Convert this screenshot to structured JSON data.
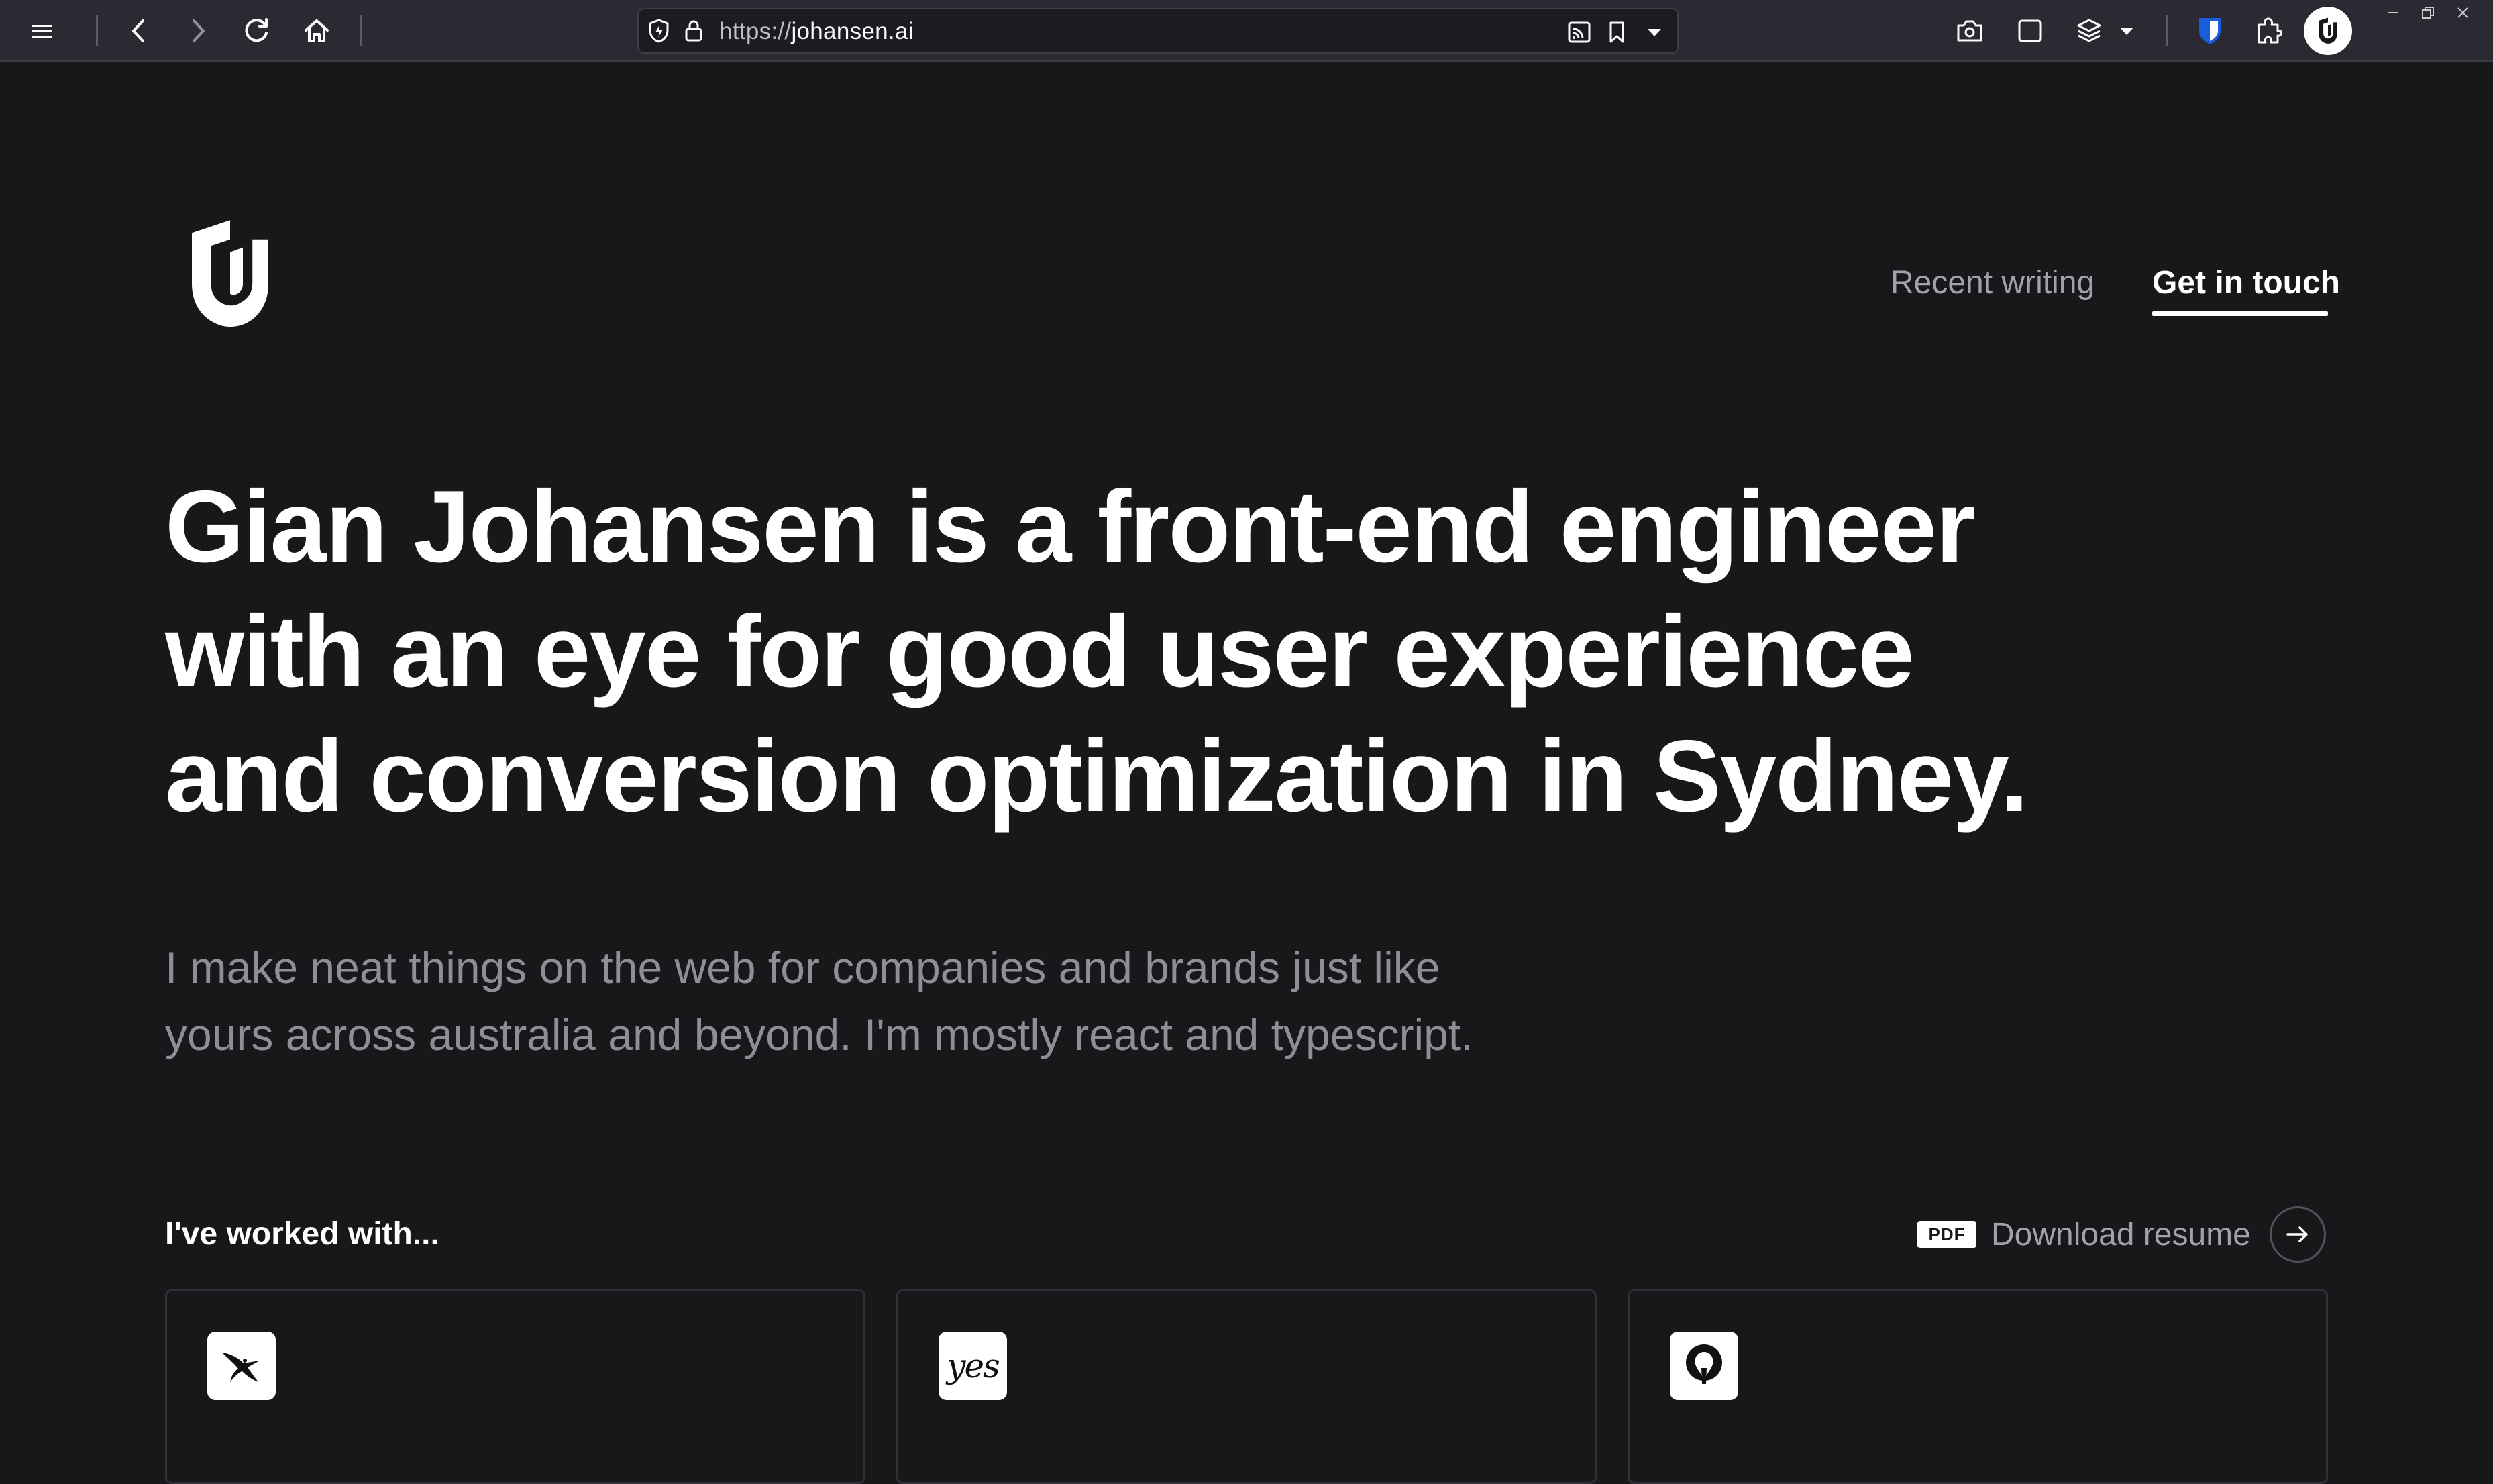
{
  "browser": {
    "url_scheme": "https://",
    "url_host": "johansen.ai",
    "icons": {
      "menu": "hamburger-menu-icon",
      "back": "back-arrow-icon",
      "forward": "forward-arrow-icon",
      "reload": "reload-icon",
      "home": "home-icon",
      "shield": "tracking-protection-icon",
      "lock": "lock-icon",
      "reader": "reader-view-icon",
      "bookmark": "bookmark-icon",
      "dropdown": "chevron-down-icon",
      "screenshot": "camera-icon",
      "sidebar": "sidebar-icon",
      "layers": "layers-icon",
      "bitwarden": "bitwarden-shield-icon",
      "extensions": "puzzle-piece-icon",
      "site_extension": "johansen-logo-icon"
    }
  },
  "nav": {
    "recent_writing": "Recent writing",
    "get_in_touch": "Get in touch"
  },
  "hero": {
    "headline_lines": [
      "Gian Johansen is a front-end engineer",
      "with an eye for good user experience",
      "and conversion optimization in Sydney."
    ],
    "subline_lines": [
      "I make neat things on the web for companies and brands just like",
      "yours across australia and beyond. I'm mostly react and typescript."
    ]
  },
  "worked_with": {
    "heading": "I've worked with...",
    "resume_badge": "PDF",
    "resume_label": "Download resume",
    "cards": [
      {
        "logo": "qantas-kangaroo-logo"
      },
      {
        "logo": "yes-logo",
        "logo_text": "yes"
      },
      {
        "logo": "hot-air-balloon-logo"
      }
    ]
  },
  "colors": {
    "page_bg": "#18181b",
    "text_primary": "#ffffff",
    "text_muted": "#8e8e96",
    "chrome_bg": "#2b2a33",
    "urlbar_bg": "#1c1b22",
    "bitwarden_blue": "#175ddc"
  }
}
